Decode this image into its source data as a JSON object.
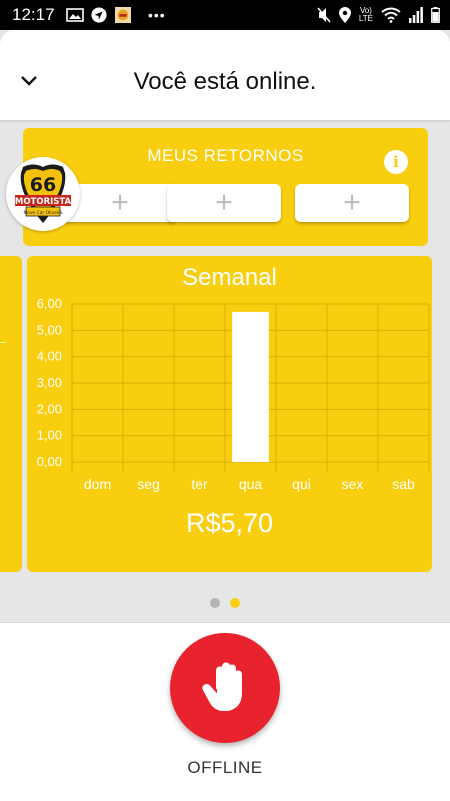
{
  "status_bar": {
    "time": "12:17",
    "left_icons": [
      "image-icon",
      "navigation-icon",
      "app-logo-icon"
    ],
    "overflow": "•••",
    "right_icons": [
      "mute-icon",
      "location-icon",
      "volte-lte-icon",
      "wifi-icon",
      "signal-icon",
      "battery-icon"
    ],
    "volte_label": "Vo)",
    "lte_label": "LTE"
  },
  "header": {
    "title": "Você está online.",
    "collapse_icon": "chevron-down-icon"
  },
  "retornos": {
    "title": "MEUS RETORNOS",
    "info_label": "i",
    "slots": [
      "+",
      "+",
      "+"
    ]
  },
  "logo": {
    "text_number": "66",
    "text_main": "MOTORISTA",
    "text_sub": "Move Car Oliveira"
  },
  "weekly": {
    "title": "Semanal",
    "total": "R$5,70"
  },
  "chart_data": {
    "type": "bar",
    "categories": [
      "dom",
      "seg",
      "ter",
      "qua",
      "qui",
      "sex",
      "sab"
    ],
    "values": [
      0,
      0,
      0,
      5.7,
      0,
      0,
      0
    ],
    "yticks": [
      "0,00",
      "1,00",
      "2,00",
      "3,00",
      "4,00",
      "5,00",
      "6,00"
    ],
    "ylim": [
      0,
      6
    ],
    "grid": true,
    "bar_color": "#ffffff",
    "grid_color": "#d9b000"
  },
  "pager": {
    "count": 2,
    "active": 2
  },
  "footer": {
    "button_icon": "hand-stop-icon",
    "label": "OFFLINE"
  },
  "colors": {
    "accent": "#f9ce0f",
    "danger": "#e8232d"
  }
}
